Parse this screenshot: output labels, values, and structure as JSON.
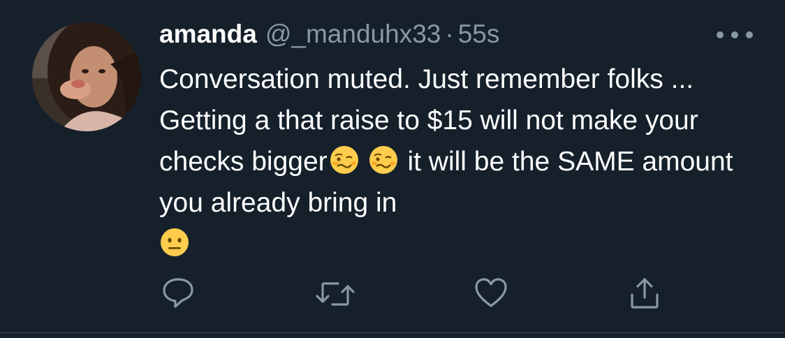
{
  "tweet": {
    "display_name": "amanda",
    "handle": "@_manduhx33",
    "separator": "·",
    "timestamp": "55s",
    "text_part_1": "Conversation muted. Just remember folks ... Getting a that raise to $15 will not make your checks bigger",
    "text_part_2": " it will be the SAME amount you already bring in",
    "emojis": [
      "woozy-face",
      "woozy-face",
      "neutral-face"
    ]
  },
  "actions": {
    "icons": [
      "reply-icon",
      "retweet-icon",
      "like-icon",
      "share-icon"
    ]
  },
  "colors": {
    "background": "#15202b",
    "text": "#ffffff",
    "secondary": "#8899a6",
    "divider": "#38444d"
  }
}
